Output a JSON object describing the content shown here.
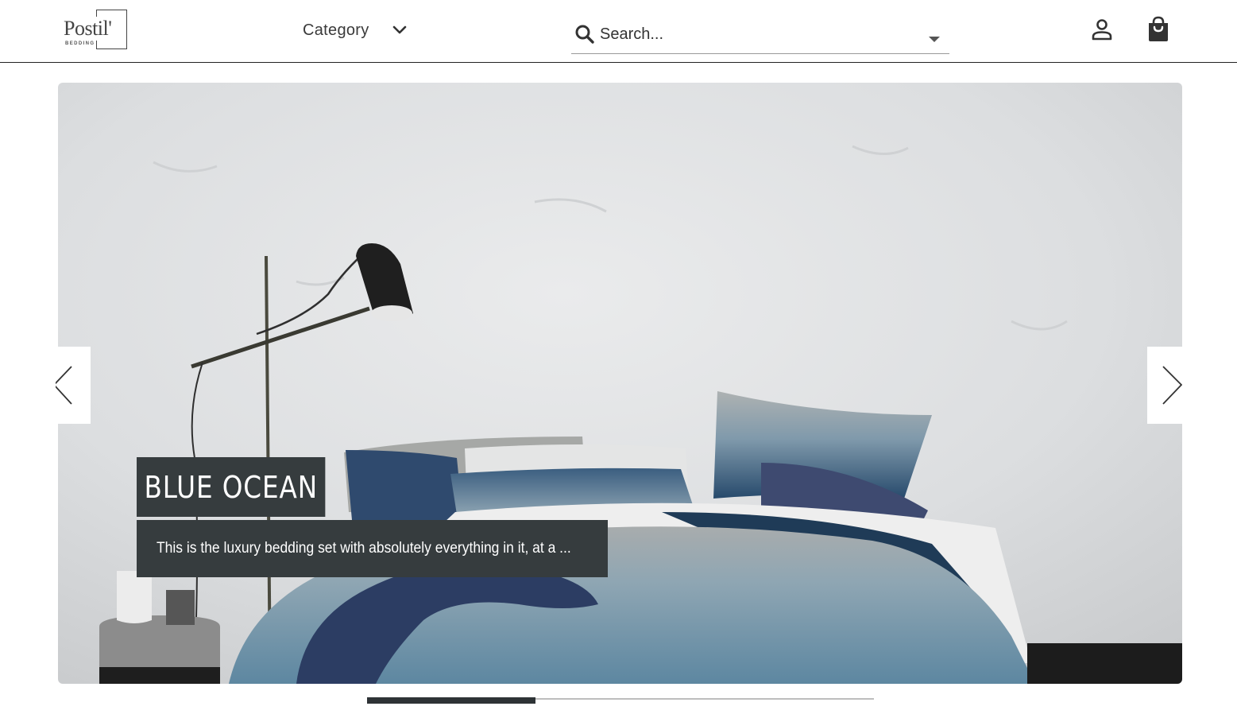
{
  "brand": {
    "name": "Postil'",
    "tagline": "BEDDING"
  },
  "nav": {
    "category_label": "Category",
    "category_icon": "chevron-down-icon"
  },
  "search": {
    "placeholder": "Search...",
    "icon": "search-icon",
    "dropdown_icon": "caret-down-icon"
  },
  "header_actions": {
    "account_icon": "user-icon",
    "cart_icon": "shopping-bag-icon"
  },
  "hero": {
    "title": "BLUE OCEAN",
    "description": "This is the luxury bedding set with absolutely everything in it, at a ...",
    "prev_icon": "chevron-left-icon",
    "next_icon": "chevron-right-icon"
  },
  "carousel": {
    "progress": 0.333
  },
  "colors": {
    "caption_bg": "#363c3e",
    "progress_fill": "#2e3336",
    "track": "#bdbdbd"
  }
}
